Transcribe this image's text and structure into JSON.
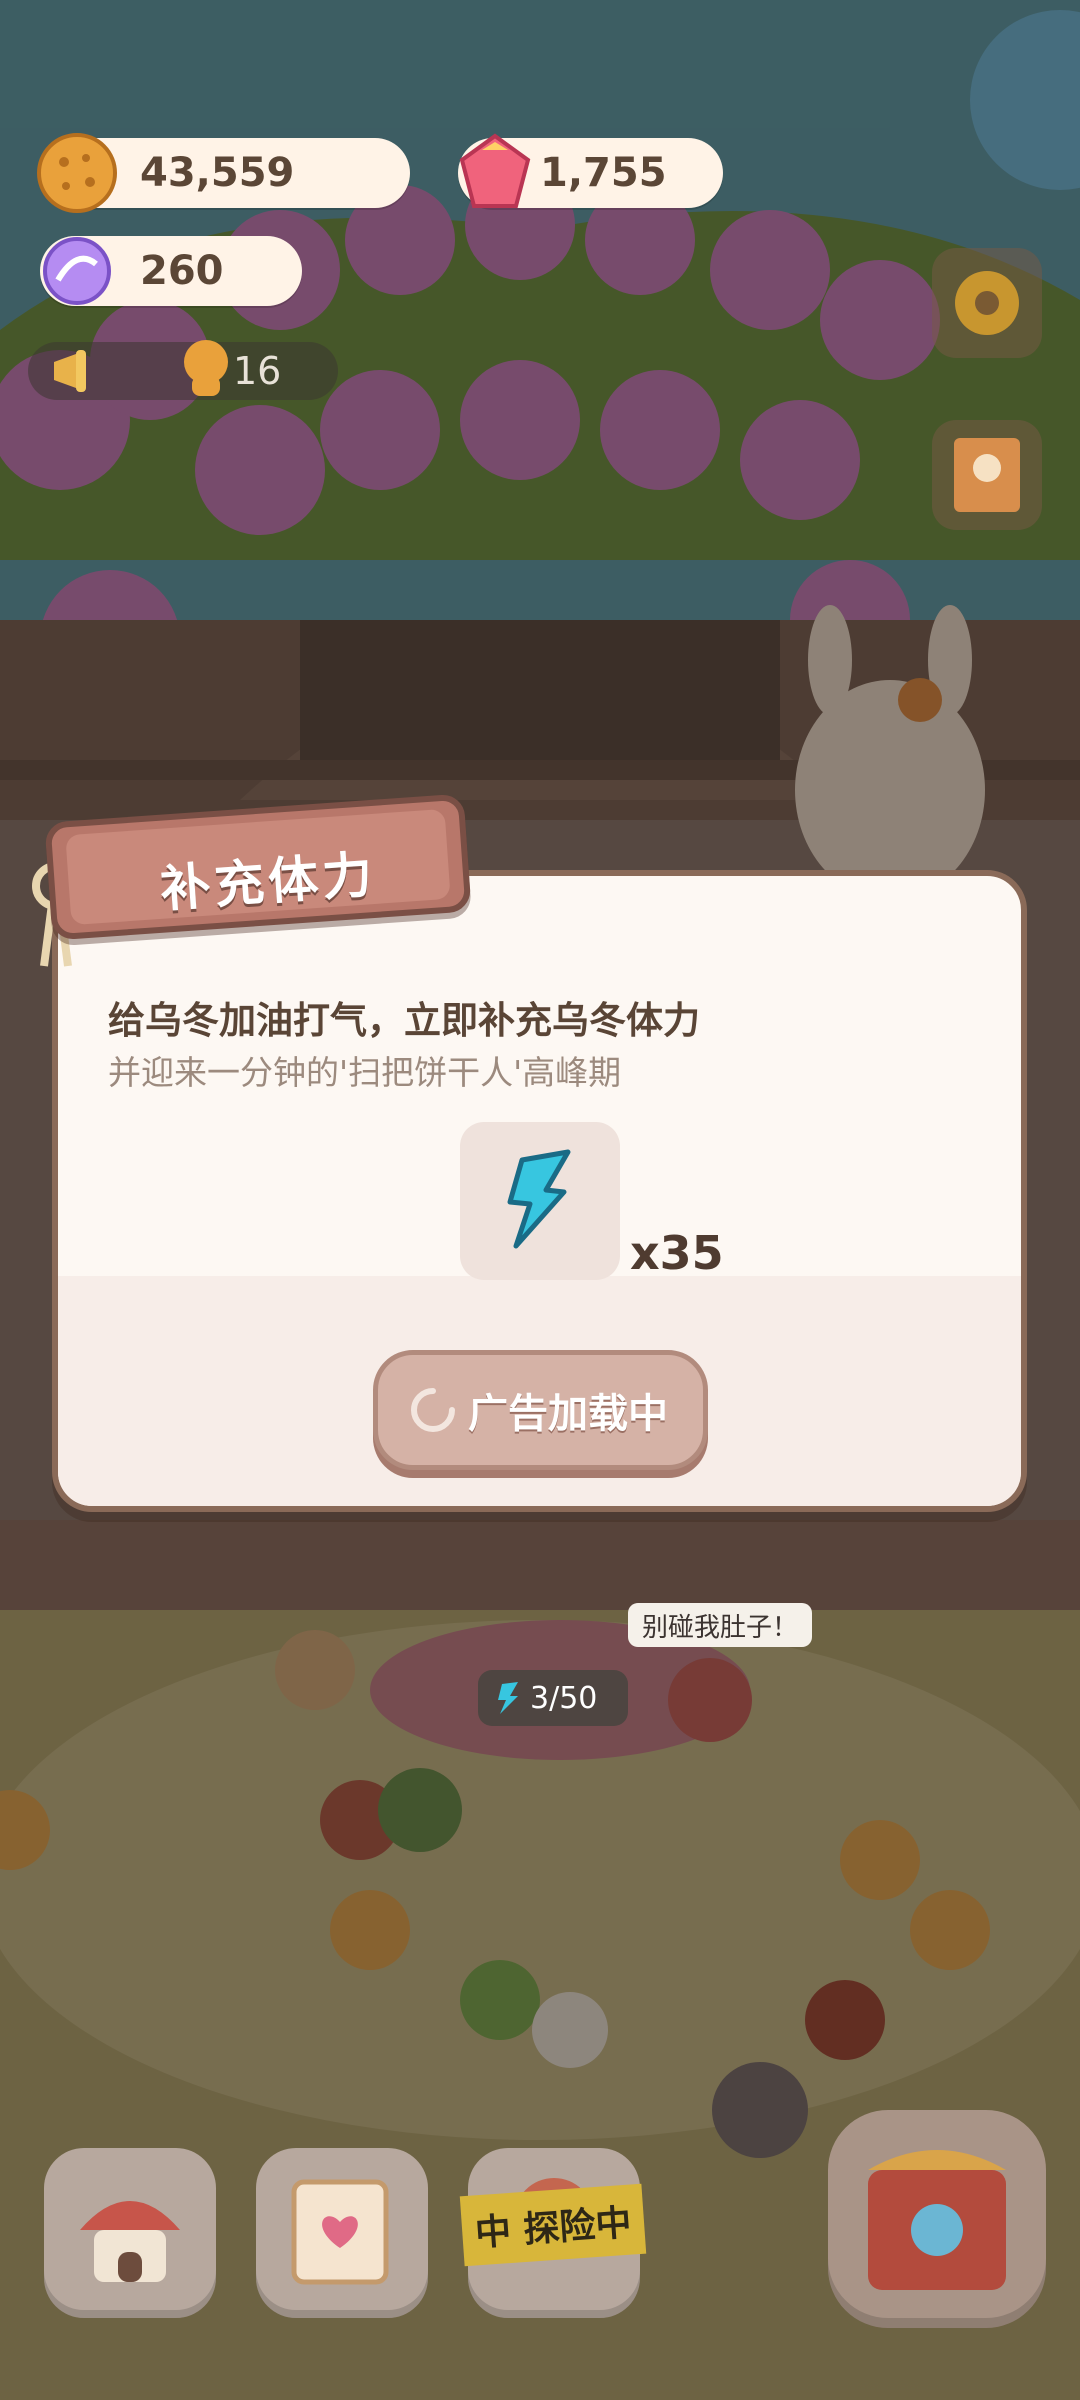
{
  "resources": {
    "cookies": "43,559",
    "gems": "1,755",
    "candy": "260"
  },
  "notice": {
    "count": "16"
  },
  "dialog": {
    "title": "补充体力",
    "line1": "给乌冬加油打气，立即补充乌冬体力",
    "line2": "并迎来一分钟的'扫把饼干人'高峰期",
    "reward_amount": "x35",
    "button_label": "广告加载中"
  },
  "scene": {
    "speech": "别碰我肚子！",
    "energy": "3/50"
  },
  "bottom_bar": {
    "explore_label": "中 探险中"
  },
  "icons": {
    "cookie": "cookie-coin-icon",
    "gem": "pink-gem-icon",
    "candy": "candy-icon",
    "notice": "megaphone-icon",
    "settings": "gear-icon",
    "reward": "lightning-energy-icon"
  },
  "colors": {
    "dialog_bg": "#fdf8f3",
    "banner": "#b8776a",
    "button": "#d5b2a6"
  }
}
